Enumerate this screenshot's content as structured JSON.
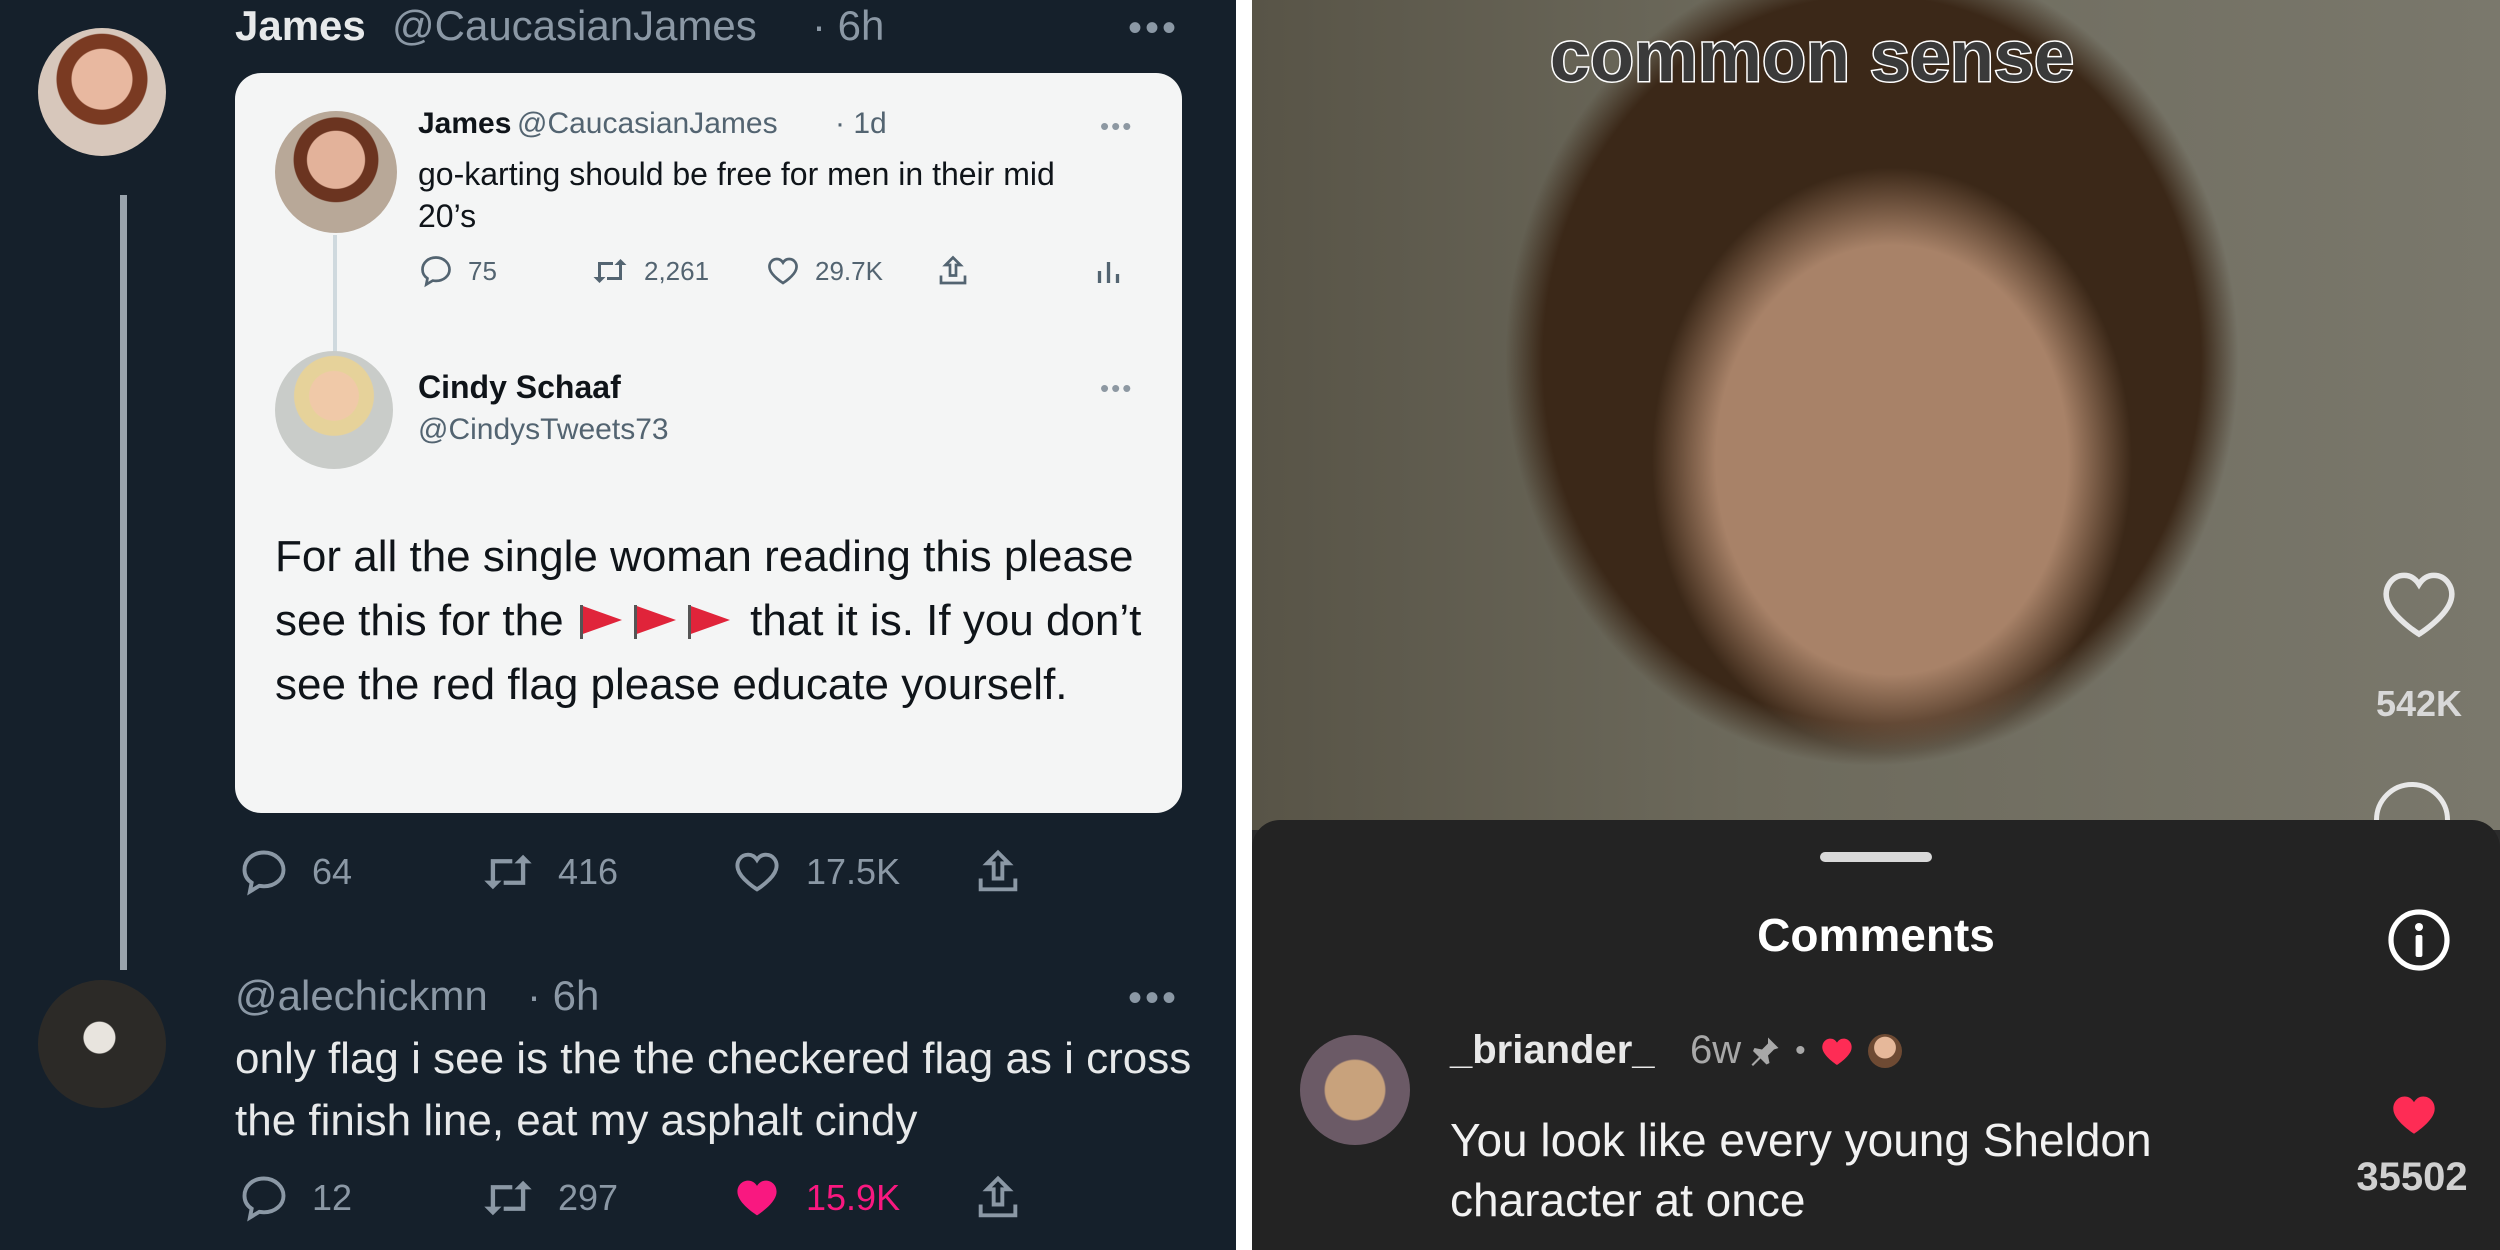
{
  "twitter": {
    "main_tweet": {
      "name": "James",
      "handle": "@CaucasianJames",
      "time": "· 6h",
      "more": "•••",
      "replies": "64",
      "retweets": "416",
      "likes": "17.5K"
    },
    "screenshot": {
      "original": {
        "name": "James",
        "handle": "@CaucasianJames",
        "time": "· 1d",
        "text": "go-karting should be free for men in their mid 20’s",
        "replies": "75",
        "retweets": "2,261",
        "likes": "29.7K",
        "more": "•••"
      },
      "reply": {
        "name": "Cindy Schaaf",
        "handle": "@CindysTweets73",
        "more": "•••",
        "text_before_flags": "For all the single woman reading this please see this for the",
        "text_after_flags": "that it is. If you don’t see the red flag please educate yourself."
      }
    },
    "reply_tweet": {
      "handle": "@alechickmn",
      "time": "· 6h",
      "more": "•••",
      "text": "only flag i see is the the checkered flag as i cross the finish line, eat my asphalt cindy",
      "replies": "12",
      "retweets": "297",
      "likes": "15.9K",
      "liked_color": "#f91880"
    }
  },
  "tiktok": {
    "overlay_caption": "common sense",
    "video_likes": "542K",
    "sheet_title": "Comments",
    "comment": {
      "username": "_briander_",
      "time": "6w",
      "text": "You look like every young Sheldon character at once",
      "likes": "35502",
      "heart_color": "#fe2c55"
    }
  }
}
